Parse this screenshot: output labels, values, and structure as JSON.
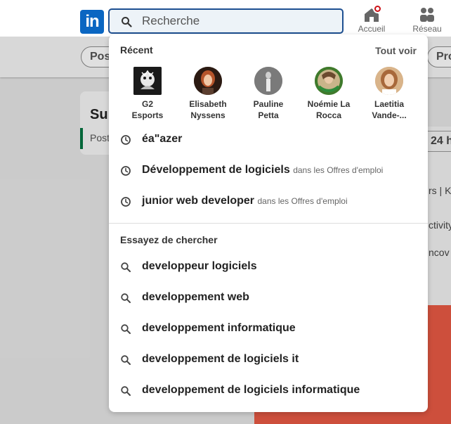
{
  "search": {
    "placeholder": "Recherche"
  },
  "nav": [
    {
      "label": "Accueil",
      "icon": "home-icon",
      "has_notification": true
    },
    {
      "label": "Réseau",
      "icon": "network-icon"
    }
  ],
  "background": {
    "pill_left": "Post",
    "pill_right": "Pro",
    "card_title": "Su",
    "card_sub": "Post",
    "right_badge": "24 h",
    "right_lines": [
      "rs | Ke",
      "ctivity",
      "ncov"
    ]
  },
  "dropdown": {
    "recent_title": "Récent",
    "see_all": "Tout voir",
    "profiles": [
      {
        "name_line1": "G2",
        "name_line2": "Esports"
      },
      {
        "name_line1": "Elisabeth",
        "name_line2": "Nyssens"
      },
      {
        "name_line1": "Pauline",
        "name_line2": "Petta"
      },
      {
        "name_line1": "Noémie La",
        "name_line2": "Rocca"
      },
      {
        "name_line1": "Laetitia",
        "name_line2": "Vande-..."
      }
    ],
    "recent_searches": [
      {
        "query": "éa\"azer",
        "context": ""
      },
      {
        "query": "Développement de logiciels",
        "context": "dans les Offres d'emploi"
      },
      {
        "query": "junior web developer",
        "context": "dans les Offres d'emploi"
      }
    ],
    "try_title": "Essayez de chercher",
    "suggestions": [
      "developpeur logiciels",
      "developpement web",
      "developpement informatique",
      "developpement de logiciels it",
      "developpement de logiciels informatique"
    ]
  },
  "colors": {
    "brand": "#0a66c2",
    "notification": "#cc1016",
    "search_border": "#1d4f91"
  }
}
